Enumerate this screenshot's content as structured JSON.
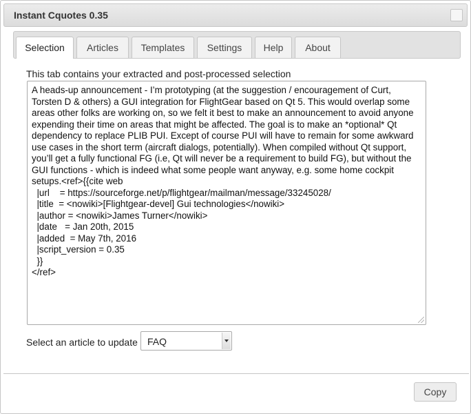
{
  "window": {
    "title": "Instant Cquotes 0.35"
  },
  "tabs": [
    {
      "label": "Selection",
      "active": true
    },
    {
      "label": "Articles",
      "active": false
    },
    {
      "label": "Templates",
      "active": false
    },
    {
      "label": "Settings",
      "active": false
    },
    {
      "label": "Help",
      "active": false
    },
    {
      "label": "About",
      "active": false
    }
  ],
  "selection": {
    "intro": "This tab contains your extracted and post-processed selection",
    "text": "A heads-up announcement - I’m prototyping (at the suggestion / encouragement of Curt, Torsten D & others) a GUI integration for FlightGear based on Qt 5. This would overlap some areas other folks are working on, so we felt it best to make an announcement to avoid anyone expending their time on areas that might be affected. The goal is to make an *optional* Qt dependency to replace PLIB PUI. Except of course PUI will have to remain for some awkward use cases in the short term (aircraft dialogs, potentially). When compiled without Qt support, you’ll get a fully functional FG (i.e, Qt will never be a requirement to build FG), but without the GUI functions - which is indeed what some people want anyway, e.g. some home cockpit setups.<ref>{{cite web\n  |url    = https://sourceforge.net/p/flightgear/mailman/message/33245028/\n  |title  = <nowiki>[Flightgear-devel] Gui technologies</nowiki>\n  |author = <nowiki>James Turner</nowiki>\n  |date   = Jan 20th, 2015\n  |added  = May 7th, 2016\n  |script_version = 0.35\n  }}\n</ref>"
  },
  "article_select": {
    "label": "Select an article to update",
    "value": "FAQ"
  },
  "footer": {
    "copy_label": "Copy"
  }
}
